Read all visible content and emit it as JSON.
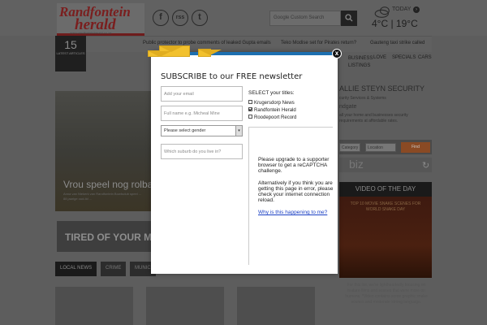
{
  "header": {
    "logo_top": "Randfontein",
    "logo_bottom": "herald",
    "logo_url": "www.randfonteinherald.co.za",
    "social": [
      "f",
      "rss",
      "t"
    ],
    "search_placeholder": "Google Custom Search",
    "weather": {
      "today": "TODAY",
      "temps": "4°C | 19°C"
    }
  },
  "ticker": {
    "count": "15",
    "count_label": "LATEST ARTICLES",
    "items": [
      "Public protector to probe comments of leaked Gupta emails",
      "Teko Modise set for Pirates return?",
      "Gauteng taxi strike called"
    ]
  },
  "nav": [
    "BUSINESS LISTINGS",
    "LOVE",
    "SPECIALS",
    "CARS"
  ],
  "main": {
    "photo_title": "Vrou speel nog rolba",
    "photo_sub": "Anna van Niekerk van Randfontein Bowlsclub speel ... 88 jaarige oud-lid ...",
    "banner_text": "TIRED OF YOUR MI",
    "tabs": [
      "LOCAL NEWS",
      "CRIME",
      "MUNIC"
    ]
  },
  "sidebar": {
    "title": "ALLIE STEYN SECURITY",
    "lines": [
      "curity Services & Systems",
      "ndgate",
      "all your home and businesses security",
      "requirements at affordable rates."
    ],
    "selects": [
      "Category",
      "Location"
    ],
    "find_label": "Find",
    "biz": "biz",
    "video_header": "VIDEO OF THE DAY",
    "video_caption": "TOP 10 MOVIE SNAKE SCENES FOR WORLD SNAKE DAY",
    "video_desc": "For this list, we're lightheartedly focusing on feature films and scenes that were more on humans. *Video contains some graphic snake scenes and moderate strong language."
  },
  "modal": {
    "title": "SUBSCRIBE to our FREE newsletter",
    "email_placeholder": "Add your email",
    "name_placeholder": "Full name e.g. Micheal Mine",
    "gender_select": "Please select gender",
    "suburb_placeholder": "Which suburb do you live in?",
    "titles_header": "SELECT your titles:",
    "titles": [
      {
        "label": "Krugersdorp News",
        "checked": false
      },
      {
        "label": "Randfontein Herald",
        "checked": true
      },
      {
        "label": "Roodepoort Record",
        "checked": false
      }
    ],
    "captcha_lines": [
      "Please upgrade to a supporter",
      "browser to get a reCAPTCHA",
      "challenge.",
      "Alternatively if you think you are",
      "getting this page in error, please",
      "check your internet connection",
      "reload."
    ],
    "captcha_link": "Why is this happening to me?",
    "close_label": "x"
  },
  "colors": {
    "accent": "#1d6fb0",
    "envelope": "#f2c12e",
    "overlay": "#5d5d5d"
  }
}
